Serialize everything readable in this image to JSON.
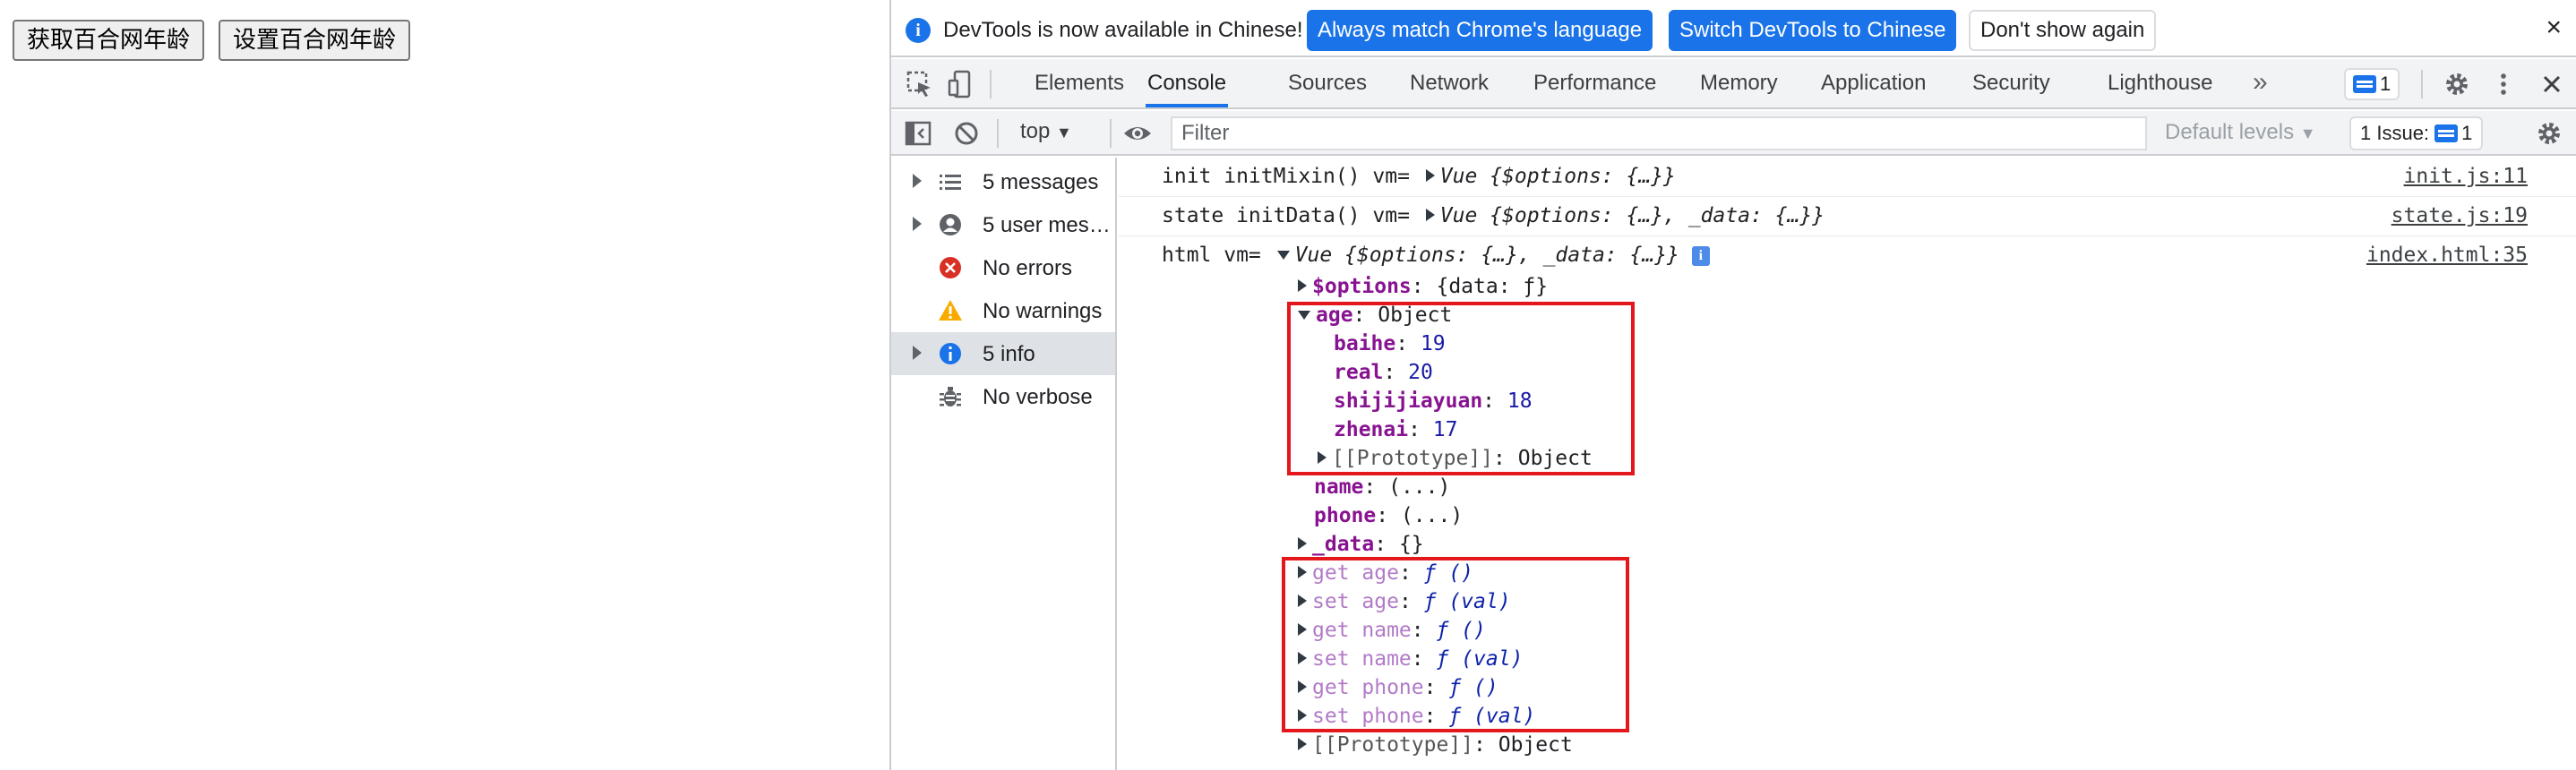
{
  "page": {
    "buttons": [
      "获取百合网年龄",
      "设置百合网年龄"
    ]
  },
  "devtools": {
    "infobar": {
      "message": "DevTools is now available in Chinese!",
      "match_label": "Always match Chrome's language",
      "switch_label": "Switch DevTools to Chinese",
      "dismiss_label": "Don't show again",
      "close": "×"
    },
    "tabs": [
      "Elements",
      "Console",
      "Sources",
      "Network",
      "Performance",
      "Memory",
      "Application",
      "Security",
      "Lighthouse"
    ],
    "active_tab": "Console",
    "more_tabs": "»",
    "message_count": "1",
    "toolbar": {
      "context": "top",
      "filter_placeholder": "Filter",
      "levels": "Default levels",
      "issues_label": "1 Issue:",
      "issues_count": "1"
    },
    "sidebar": [
      {
        "label": "5 messages",
        "icon": "list-icon",
        "expandable": true,
        "selected": false
      },
      {
        "label": "5 user mes…",
        "icon": "user-icon",
        "expandable": true,
        "selected": false
      },
      {
        "label": "No errors",
        "icon": "error-icon",
        "expandable": false,
        "selected": false
      },
      {
        "label": "No warnings",
        "icon": "warning-icon",
        "expandable": false,
        "selected": false
      },
      {
        "label": "5 info",
        "icon": "info-icon",
        "expandable": true,
        "selected": true
      },
      {
        "label": "No verbose",
        "icon": "bug-icon",
        "expandable": false,
        "selected": false
      }
    ],
    "console": {
      "messages": [
        {
          "prefix": "init initMixin() vm= ",
          "obj": "Vue {$options: {…}}",
          "source": "init.js:11"
        },
        {
          "prefix": "state initData() vm= ",
          "obj": "Vue {$options: {…}, _data: {…}}",
          "source": "state.js:19"
        },
        {
          "prefix": "html vm= ",
          "obj": "Vue {$options: {…}, _data: {…}}",
          "source": "index.html:35",
          "info_badge": "i"
        }
      ],
      "tree": {
        "options": {
          "key": "$options",
          "value": "{data: ƒ}"
        },
        "age": {
          "key": "age",
          "value": "Object",
          "props": [
            {
              "key": "baihe",
              "value": "19"
            },
            {
              "key": "real",
              "value": "20"
            },
            {
              "key": "shijijiayuan",
              "value": "18"
            },
            {
              "key": "zhenai",
              "value": "17"
            }
          ],
          "proto": {
            "key": "[[Prototype]]",
            "value": "Object"
          }
        },
        "name": {
          "key": "name",
          "value": "(...)"
        },
        "phone": {
          "key": "phone",
          "value": "(...)"
        },
        "data": {
          "key": "_data",
          "value": "{}"
        },
        "accessors": [
          {
            "key": "get age",
            "value": "ƒ ()"
          },
          {
            "key": "set age",
            "value": "ƒ (val)"
          },
          {
            "key": "get name",
            "value": "ƒ ()"
          },
          {
            "key": "set name",
            "value": "ƒ (val)"
          },
          {
            "key": "get phone",
            "value": "ƒ ()"
          },
          {
            "key": "set phone",
            "value": "ƒ (val)"
          }
        ],
        "proto": {
          "key": "[[Prototype]]",
          "value": "Object"
        }
      }
    },
    "colors": {
      "accent": "#1a73e8",
      "highlight": "#e3171c",
      "key": "#881391",
      "number": "#1a1aa6"
    }
  }
}
